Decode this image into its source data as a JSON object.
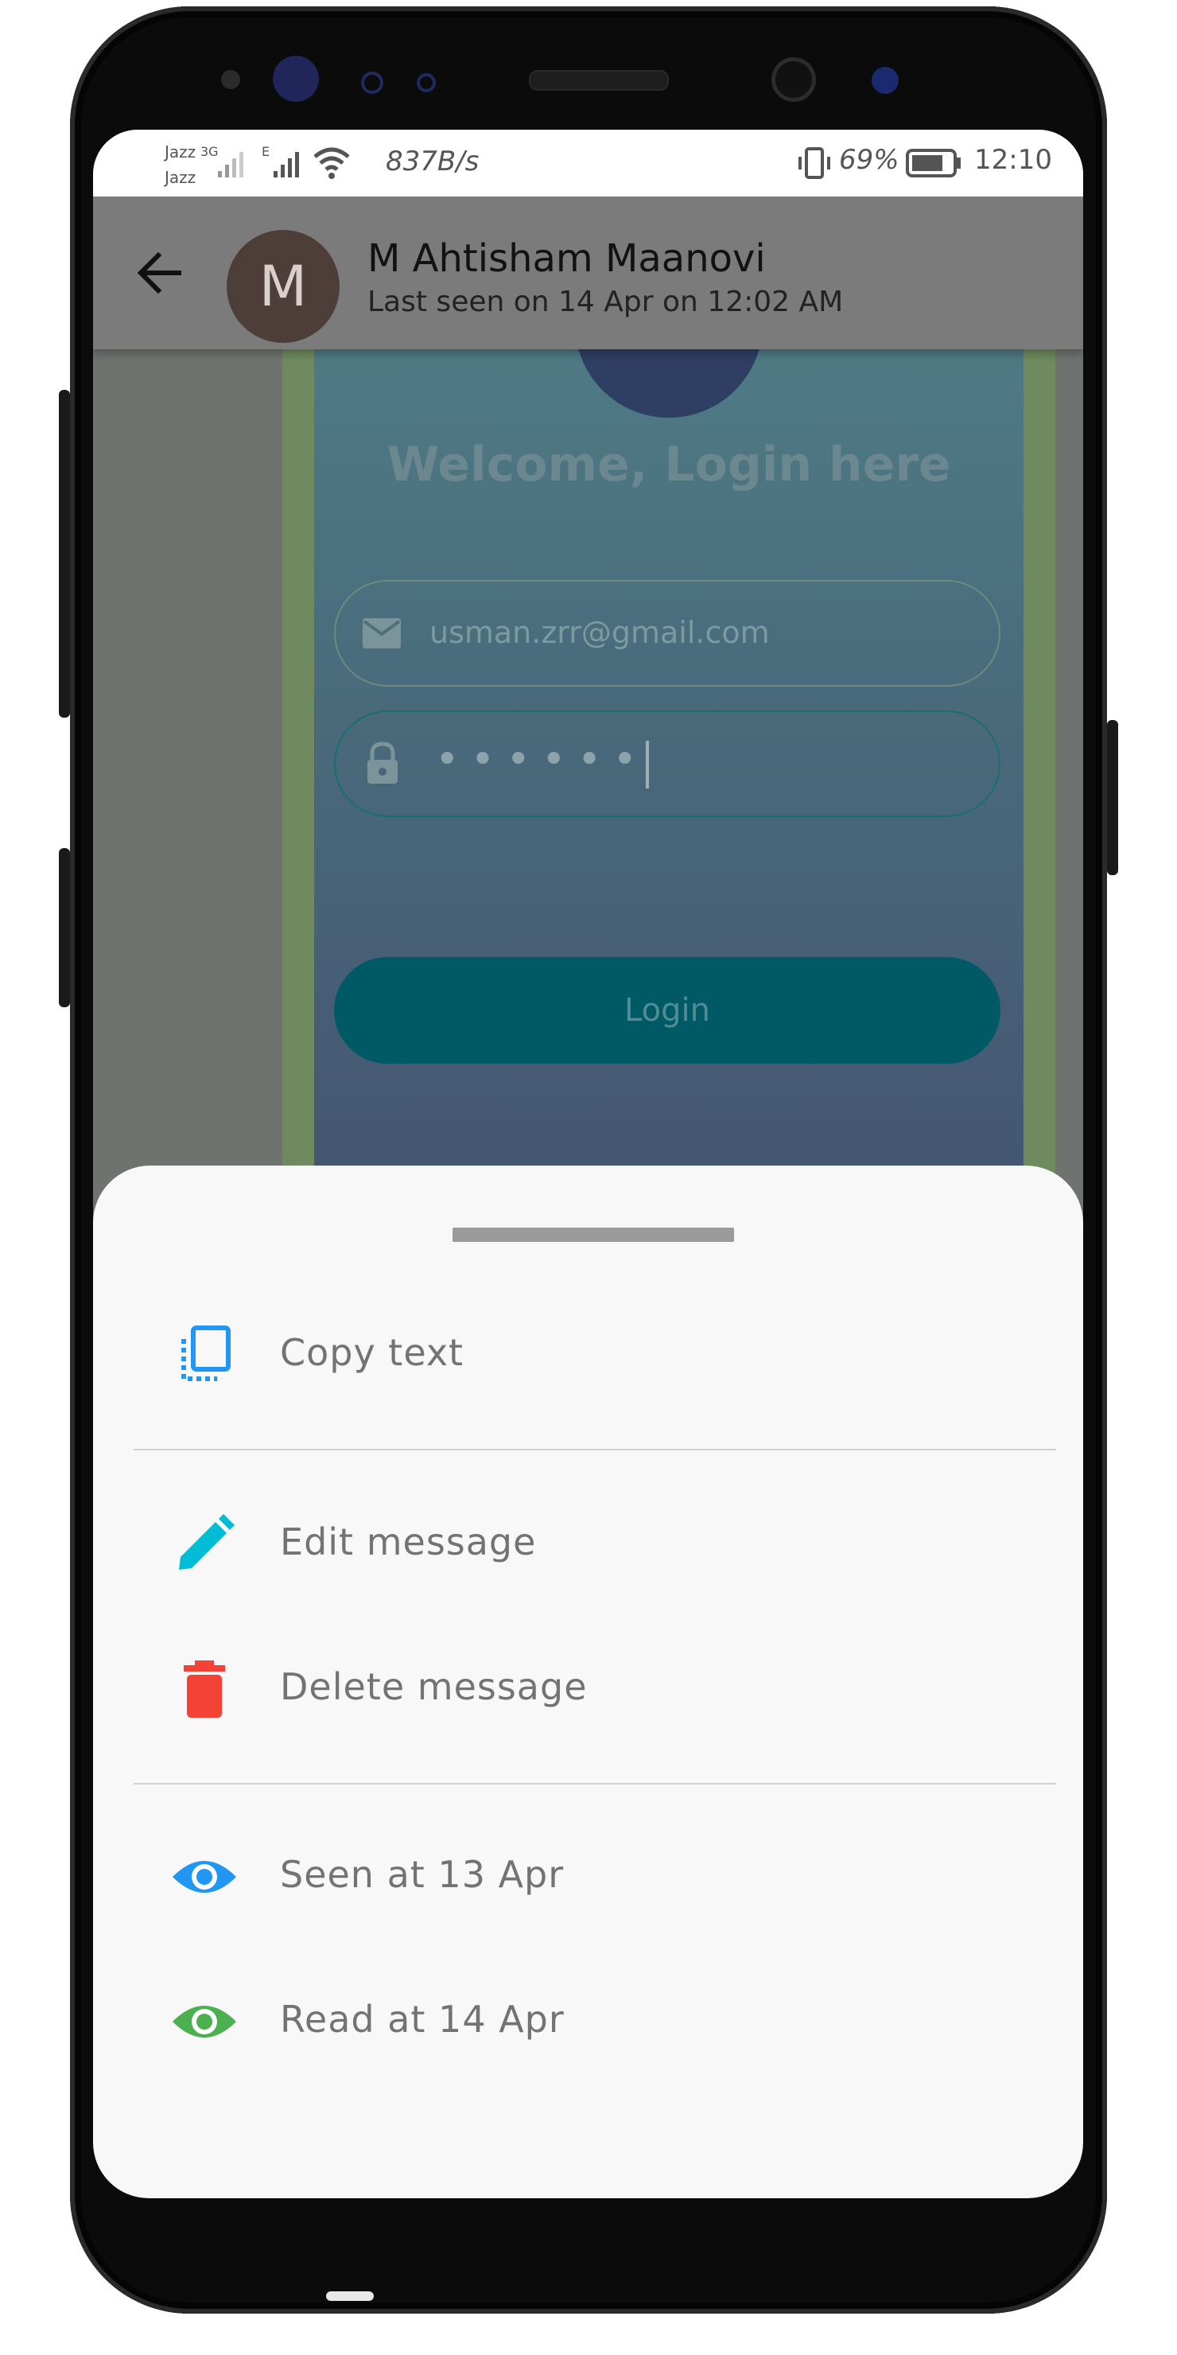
{
  "status_bar": {
    "carrier_top": "Jazz",
    "carrier_bottom": "Jazz",
    "network_3g": "3G",
    "network_e": "E",
    "speed": "837B/s",
    "battery": "69%",
    "time": "12:10"
  },
  "app_bar": {
    "avatar_letter": "M",
    "contact_name": "M Ahtisham Maanovi",
    "last_seen": "Last seen on 14 Apr on 12:02 AM"
  },
  "chat_image": {
    "welcome_text": "Welcome, Login here",
    "email_value": "usman.zrr@gmail.com",
    "password_mask": "••••••",
    "login_label": "Login"
  },
  "bottom_sheet": {
    "copy_text": "Copy text",
    "edit_message": "Edit message",
    "delete_message": "Delete message",
    "seen_at": "Seen at  13 Apr",
    "read_at": "Read at  14 Apr"
  },
  "colors": {
    "copy_icon": "#2196f3",
    "edit_icon": "#00bcd4",
    "delete_icon": "#f44336",
    "seen_icon": "#2196f3",
    "read_icon": "#4caf50"
  }
}
